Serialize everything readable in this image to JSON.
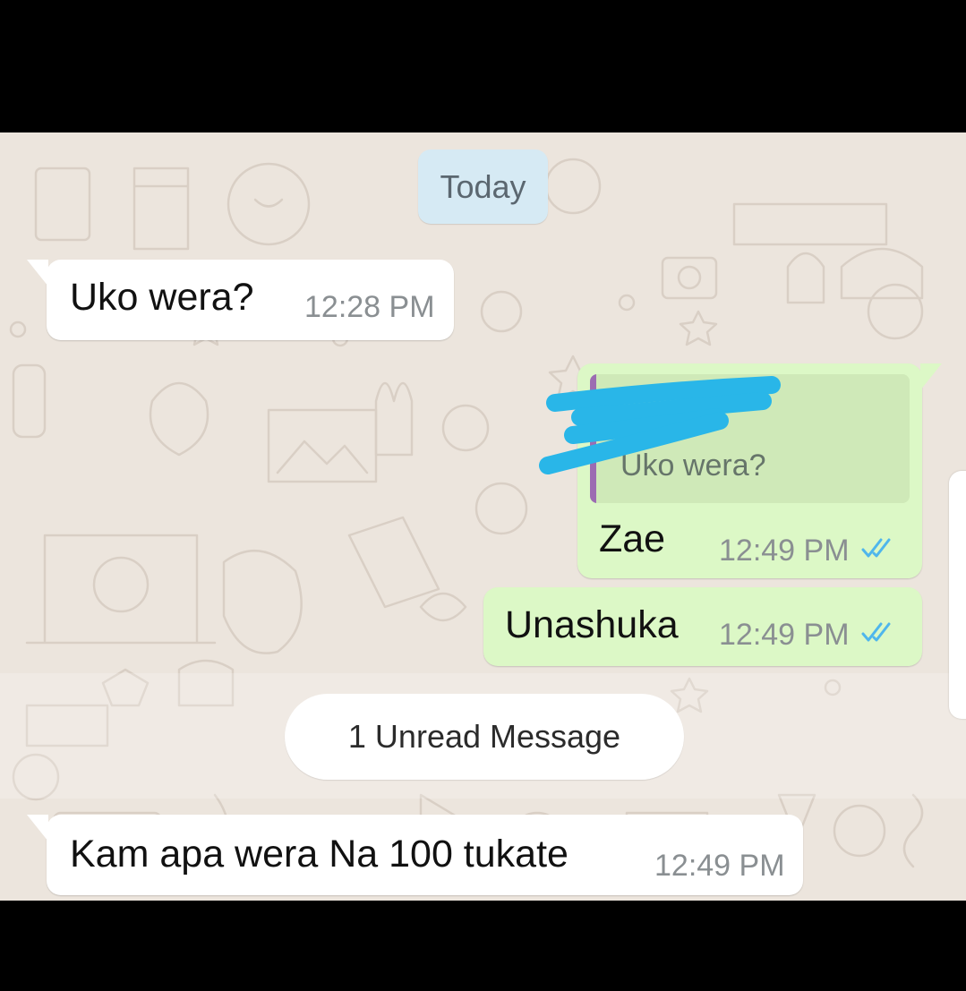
{
  "date_chip": "Today",
  "messages": [
    {
      "direction": "incoming",
      "text": "Uko wera?",
      "time": "12:28 PM"
    },
    {
      "direction": "outgoing",
      "quoted_text": "Uko wera?",
      "text": "Zae",
      "time": "12:49 PM",
      "ticks": "double-check-blue-icon"
    },
    {
      "direction": "outgoing",
      "text": "Unashuka",
      "time": "12:49 PM",
      "ticks": "double-check-blue-icon"
    },
    {
      "direction": "incoming",
      "text": "Kam apa wera Na 100 tukate",
      "time": "12:49 PM"
    }
  ],
  "unread_divider": "1 Unread Message",
  "colors": {
    "chat_background": "#ece5dd",
    "incoming_bubble": "#ffffff",
    "outgoing_bubble": "#dcf8c6",
    "quote_bar": "#9c6cb2",
    "read_ticks": "#4fb6ec",
    "scribble": "#29b6e8"
  }
}
